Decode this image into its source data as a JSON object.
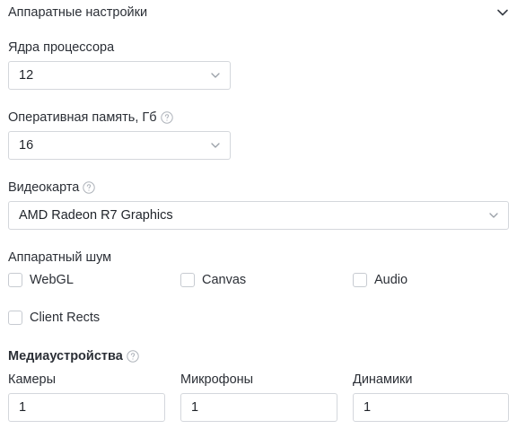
{
  "section": {
    "title": "Аппаратные настройки",
    "collapse_icon": "chevron-down-icon"
  },
  "cpu": {
    "label": "Ядра процессора",
    "value": "12"
  },
  "ram": {
    "label": "Оперативная память, Гб",
    "value": "16"
  },
  "gpu": {
    "label": "Видеокарта",
    "value": "AMD Radeon R7 Graphics"
  },
  "noise": {
    "label": "Аппаратный шум",
    "options": [
      {
        "label": "WebGL",
        "checked": false
      },
      {
        "label": "Canvas",
        "checked": false
      },
      {
        "label": "Audio",
        "checked": false
      },
      {
        "label": "Client Rects",
        "checked": false
      }
    ]
  },
  "media": {
    "label": "Медиаустройства",
    "cameras": {
      "label": "Камеры",
      "value": "1"
    },
    "microphones": {
      "label": "Микрофоны",
      "value": "1"
    },
    "speakers": {
      "label": "Динамики",
      "value": "1"
    }
  },
  "colors": {
    "border": "#d4d7dc",
    "text": "#2b2f36",
    "icon": "#9aa0a8"
  }
}
